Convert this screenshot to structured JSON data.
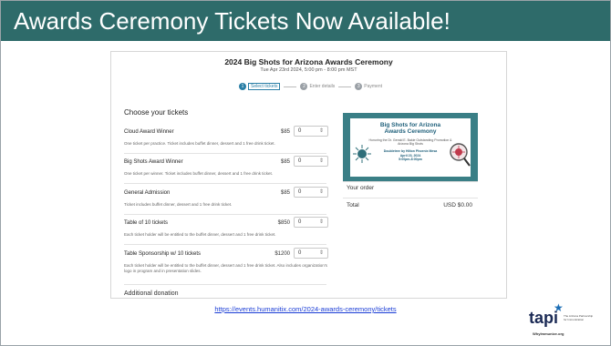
{
  "slide": {
    "title": "Awards Ceremony Tickets Now Available!",
    "link": "https://events.humanitix.com/2024-awards-ceremony/tickets"
  },
  "event": {
    "title": "2024 Big Shots for Arizona Awards Ceremony",
    "date": "Tue Apr 23rd 2024, 5:00 pm - 8:00 pm MST"
  },
  "steps": [
    {
      "num": "1",
      "label": "Select tickets"
    },
    {
      "num": "2",
      "label": "Enter details"
    },
    {
      "num": "3",
      "label": "Payment"
    }
  ],
  "choose_heading": "Choose your tickets",
  "tickets": [
    {
      "name": "Cloud Award Winner",
      "price": "$85",
      "qty": "0",
      "desc": "One ticket per practice. Ticket includes buffet dinner, dessert and 1 free drink ticket."
    },
    {
      "name": "Big Shots Award Winner",
      "price": "$85",
      "qty": "0",
      "desc": "One ticket per winner. Ticket includes buffet dinner, dessert and 1 free drink ticket."
    },
    {
      "name": "General Admission",
      "price": "$85",
      "qty": "0",
      "desc": "Ticket includes buffet dinner, dessert and 1 free drink ticket."
    },
    {
      "name": "Table of 10 tickets",
      "price": "$850",
      "qty": "0",
      "desc": "Each ticket holder will be entitled to the buffet dinner, dessert and 1 free drink ticket."
    },
    {
      "name": "Table Sponsorship w/ 10 tickets",
      "price": "$1200",
      "qty": "0",
      "desc": "Each ticket holder will be entitled to the buffet dinner, dessert and 1 free drink ticket. Also includes organization's logo in program and in presentation slides."
    }
  ],
  "additional_heading": "Additional donation",
  "banner": {
    "title_line1": "Big Shots for Arizona",
    "title_line2": "Awards Ceremony",
    "subtitle": "Honoring the Dr. Gerald E. Bakie Outstanding Promotion & Arizona Big Shots",
    "date_line1": "Doubletree by Hilton Phoenix Mesa",
    "date_line2": "April 23, 2024",
    "date_line3": "5:00pm-8:00pm"
  },
  "order": {
    "title": "Your order",
    "total_label": "Total",
    "total_value": "USD $0.00"
  },
  "logo": {
    "word": "tapi",
    "tagline": "The Arizona Partnership for Immunization",
    "url": "WhyImmunize.org"
  },
  "colors": {
    "title_bar": "#2e6b6a",
    "step_active": "#2a7fa6",
    "link": "#1a3dd6"
  }
}
